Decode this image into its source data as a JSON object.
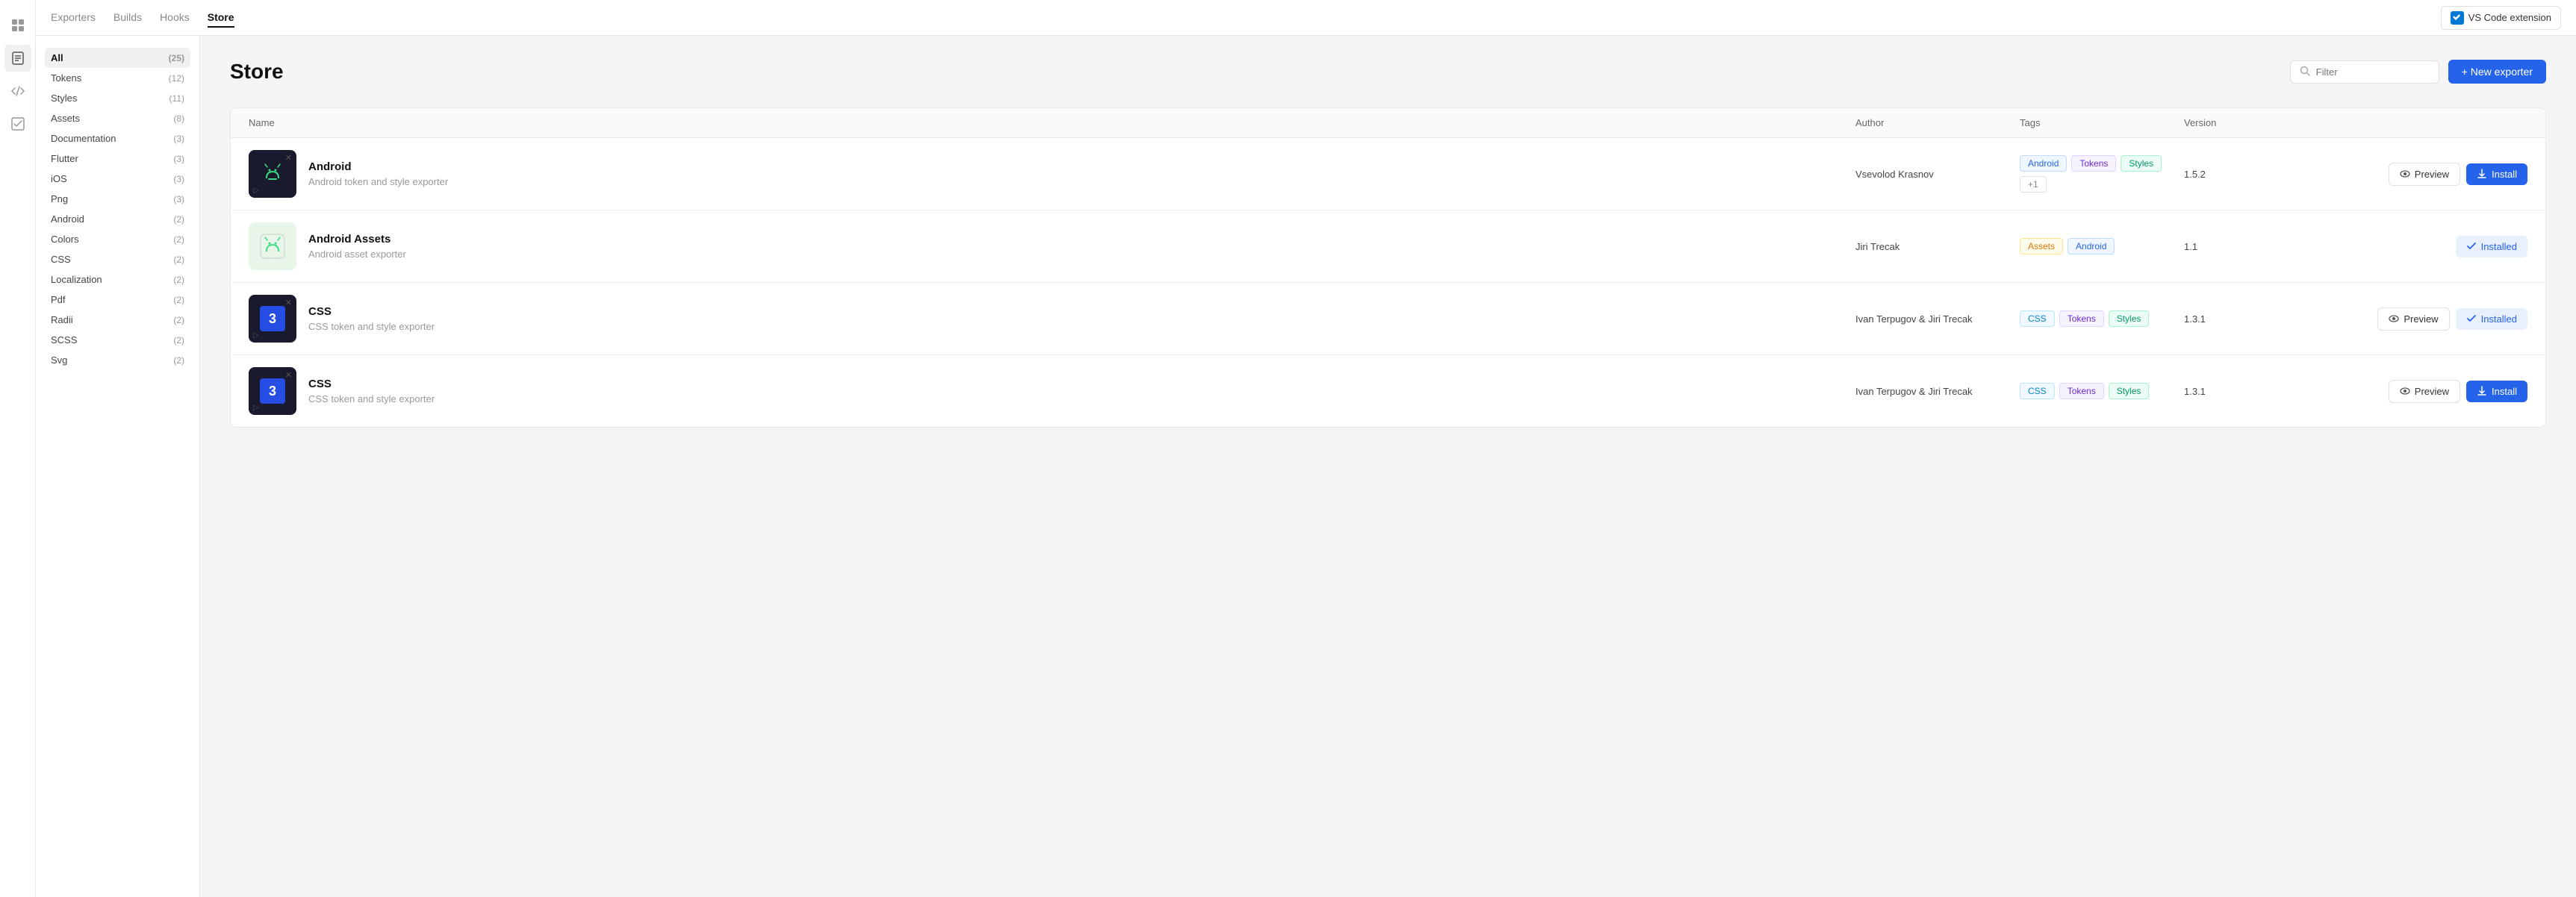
{
  "nav": {
    "tabs": [
      {
        "id": "exporters",
        "label": "Exporters",
        "active": false
      },
      {
        "id": "builds",
        "label": "Builds",
        "active": false
      },
      {
        "id": "hooks",
        "label": "Hooks",
        "active": false
      },
      {
        "id": "store",
        "label": "Store",
        "active": true
      }
    ],
    "vscode_button": "VS Code extension"
  },
  "sidebar": {
    "items": [
      {
        "id": "all",
        "label": "All",
        "count": "(25)",
        "active": true
      },
      {
        "id": "tokens",
        "label": "Tokens",
        "count": "(12)",
        "active": false
      },
      {
        "id": "styles",
        "label": "Styles",
        "count": "(11)",
        "active": false
      },
      {
        "id": "assets",
        "label": "Assets",
        "count": "(8)",
        "active": false
      },
      {
        "id": "documentation",
        "label": "Documentation",
        "count": "(3)",
        "active": false
      },
      {
        "id": "flutter",
        "label": "Flutter",
        "count": "(3)",
        "active": false
      },
      {
        "id": "ios",
        "label": "iOS",
        "count": "(3)",
        "active": false
      },
      {
        "id": "png",
        "label": "Png",
        "count": "(3)",
        "active": false
      },
      {
        "id": "android",
        "label": "Android",
        "count": "(2)",
        "active": false
      },
      {
        "id": "colors",
        "label": "Colors",
        "count": "(2)",
        "active": false
      },
      {
        "id": "css",
        "label": "CSS",
        "count": "(2)",
        "active": false
      },
      {
        "id": "localization",
        "label": "Localization",
        "count": "(2)",
        "active": false
      },
      {
        "id": "pdf",
        "label": "Pdf",
        "count": "(2)",
        "active": false
      },
      {
        "id": "radii",
        "label": "Radii",
        "count": "(2)",
        "active": false
      },
      {
        "id": "scss",
        "label": "SCSS",
        "count": "(2)",
        "active": false
      },
      {
        "id": "svg",
        "label": "Svg",
        "count": "(2)",
        "active": false
      }
    ]
  },
  "page": {
    "title": "Store",
    "filter_placeholder": "Filter",
    "new_exporter_label": "+ New exporter"
  },
  "table": {
    "headers": {
      "name": "Name",
      "author": "Author",
      "tags": "Tags",
      "version": "Version"
    },
    "rows": [
      {
        "id": "android-1",
        "name": "Android",
        "description": "Android token and style exporter",
        "author": "Vsevolod Krasnov",
        "tags": [
          "Android",
          "Tokens",
          "Styles",
          "+1"
        ],
        "version": "1.5.2",
        "thumb_type": "android",
        "actions": {
          "preview": true,
          "install": "install"
        }
      },
      {
        "id": "android-assets",
        "name": "Android Assets",
        "description": "Android asset exporter",
        "author": "Jiri Trecak",
        "tags": [
          "Assets",
          "Android"
        ],
        "version": "1.1",
        "thumb_type": "android-assets",
        "actions": {
          "preview": false,
          "install": "installed"
        }
      },
      {
        "id": "css-1",
        "name": "CSS",
        "description": "CSS token and style exporter",
        "author": "Ivan Terpugov & Jiri Trecak",
        "tags": [
          "CSS",
          "Tokens",
          "Styles"
        ],
        "version": "1.3.1",
        "thumb_type": "css",
        "actions": {
          "preview": true,
          "install": "installed"
        }
      },
      {
        "id": "css-2",
        "name": "CSS",
        "description": "CSS token and style exporter",
        "author": "Ivan Terpugov & Jiri Trecak",
        "tags": [
          "CSS",
          "Tokens",
          "Styles"
        ],
        "version": "1.3.1",
        "thumb_type": "css",
        "actions": {
          "preview": true,
          "install": "install"
        }
      }
    ]
  },
  "icons": {
    "search": "🔍",
    "eye": "👁",
    "download": "⬇",
    "check": "✓",
    "plus": "+"
  }
}
